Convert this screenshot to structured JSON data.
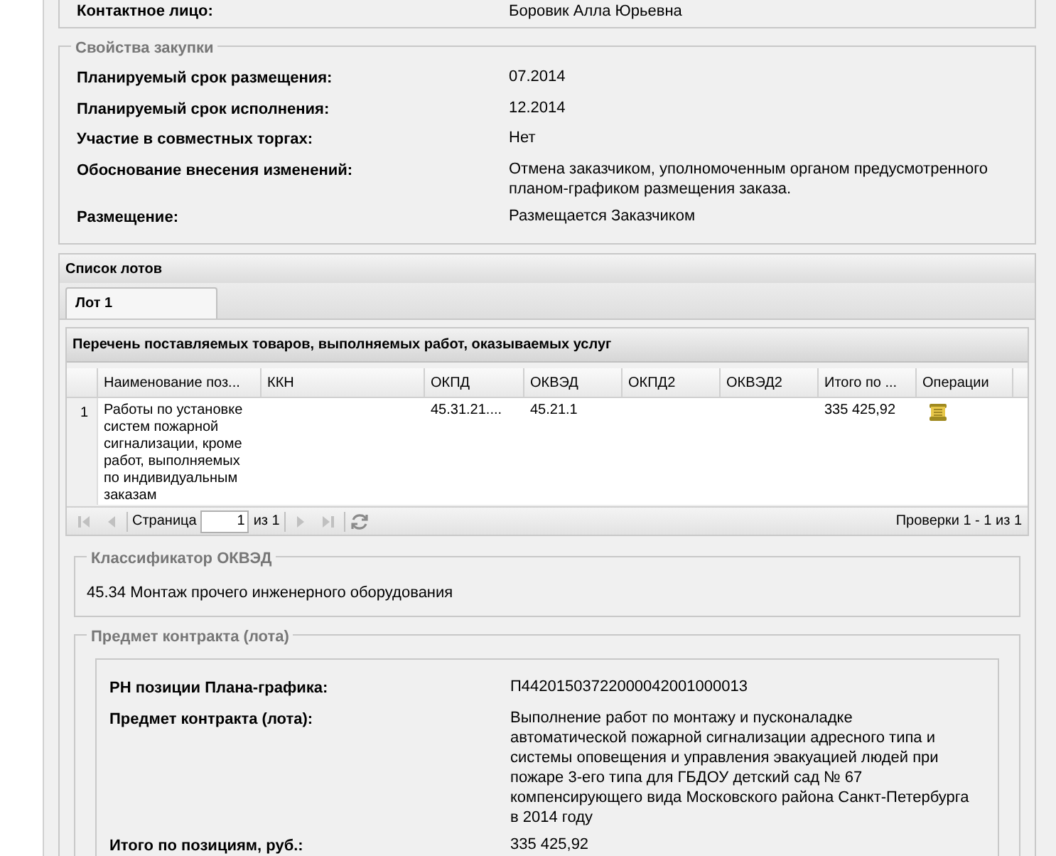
{
  "contact": {
    "label": "Контактное лицо:",
    "value": "Боровик Алла Юрьевна"
  },
  "procurement": {
    "title": "Свойства закупки",
    "fields": [
      {
        "label": "Планируемый срок размещения:",
        "value": "07.2014"
      },
      {
        "label": "Планируемый срок исполнения:",
        "value": "12.2014"
      },
      {
        "label": "Участие в совместных торгах:",
        "value": "Нет"
      },
      {
        "label": "Обоснование внесения изменений:",
        "value": "Отмена заказчиком, уполномоченным органом предусмотренного планом-графиком размещения заказа."
      },
      {
        "label": "Размещение:",
        "value": "Размещается Заказчиком"
      }
    ]
  },
  "lots": {
    "title": "Список лотов",
    "tabs": [
      {
        "label": "Лот 1",
        "selected": true
      }
    ],
    "goods": {
      "title": "Перечень поставляемых товаров, выполняемых работ, оказываемых услуг",
      "columns": [
        "Наименование поз...",
        "ККН",
        "ОКПД",
        "ОКВЭД",
        "ОКПД2",
        "ОКВЭД2",
        "Итого по ...",
        "Операции"
      ],
      "rows": [
        {
          "number": "1",
          "cells": [
            "Работы по установке систем пожарной сигнализации, кроме работ, выполняемых по индивидуальным заказам",
            "",
            "45.31.21....",
            "45.21.1",
            "",
            "",
            "335 425,92"
          ]
        }
      ],
      "pager": {
        "page_label": "Страница",
        "page": "1",
        "of": "из 1",
        "summary": "Проверки 1 - 1 из 1",
        "first_disabled": true,
        "prev_disabled": true,
        "next_disabled": true,
        "last_disabled": true
      }
    },
    "okved": {
      "title": "Классификатор ОКВЭД",
      "value": "45.34 Монтаж прочего инженерного оборудования"
    },
    "subject": {
      "title": "Предмет контракта (лота)",
      "fields": [
        {
          "label": "РН позиции Плана-графика:",
          "value": "П44201503722000042001000013"
        },
        {
          "label": "Предмет контракта (лота):",
          "value": "Выполнение работ по монтажу и пусконаладке автоматической пожарной сигнализации адресного типа и системы оповещения и управления эвакуацией людей при пожаре 3-его типа для ГБДОУ детский сад № 67 компенсирующего вида Московского района Санкт-Петербурга в 2014 году"
        },
        {
          "label": "Итого по позициям, руб.:",
          "value": "335 425,92"
        }
      ]
    }
  }
}
